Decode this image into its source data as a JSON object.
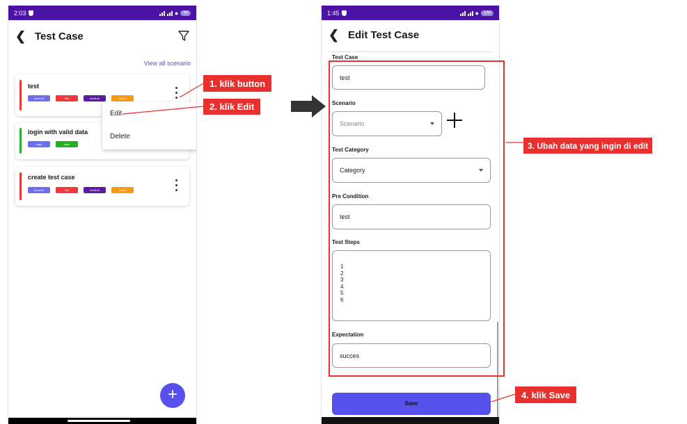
{
  "left_screen": {
    "status": {
      "time": "2:03",
      "battery": "99"
    },
    "title": "Test Case",
    "view_all": "View all scenario",
    "cards": [
      {
        "title": "test",
        "strip_color": "#e53935",
        "tags": [
          {
            "label": "account",
            "color": "#6d6ef0"
          },
          {
            "label": "fail",
            "color": "#f0393a"
          },
          {
            "label": "medium",
            "color": "#5a1ea0"
          },
          {
            "label": "minor",
            "color": "#f39c16"
          }
        ]
      },
      {
        "title": "login with valid data",
        "strip_color": "#2db32d",
        "tags": [
          {
            "label": "login",
            "color": "#6d6ef0"
          },
          {
            "label": "pass",
            "color": "#23b023"
          }
        ]
      },
      {
        "title": "create test case",
        "strip_color": "#e53935",
        "tags": [
          {
            "label": "account",
            "color": "#6d6ef0"
          },
          {
            "label": "fail",
            "color": "#f0393a"
          },
          {
            "label": "medium",
            "color": "#5a1ea0"
          },
          {
            "label": "minor",
            "color": "#f39c16"
          }
        ]
      }
    ],
    "menu": {
      "edit": "Edit",
      "delete": "Delete"
    },
    "fab": "+"
  },
  "right_screen": {
    "status": {
      "time": "1:45",
      "battery": "100"
    },
    "title": "Edit Test Case",
    "fields": {
      "test_case": {
        "label": "Test Case",
        "value": "test"
      },
      "scenario": {
        "label": "Scenario",
        "placeholder": "Scenario"
      },
      "category": {
        "label": "Test Category",
        "value": "Category"
      },
      "pre_condition": {
        "label": "Pre Condition",
        "value": "test"
      },
      "test_steps": {
        "label": "Test Steps",
        "lines": [
          "1",
          "2",
          "3",
          "4",
          "5",
          "6"
        ]
      },
      "expectation": {
        "label": "Expectation",
        "value": "succes"
      }
    },
    "save": "Save"
  },
  "annotations": {
    "step1": "1. klik button",
    "step2": "2. klik Edit",
    "step3": "3. Ubah data yang ingin di edit",
    "step4": "4. klik Save"
  },
  "colors": {
    "accent": "#5650ec",
    "status_bar": "#4a12a5",
    "annotation": "#e8302e"
  }
}
